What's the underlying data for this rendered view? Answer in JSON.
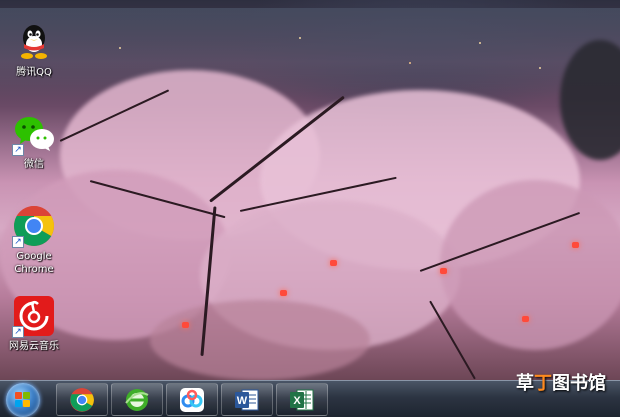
{
  "desktop": {
    "icons": [
      {
        "label": "腾讯QQ",
        "icon": "qq-penguin-icon"
      },
      {
        "label": "微信",
        "icon": "wechat-icon"
      },
      {
        "label": "Google\nChrome",
        "icon": "chrome-icon"
      },
      {
        "label": "网易云音乐",
        "icon": "netease-music-icon"
      }
    ]
  },
  "taskbar": {
    "start": {
      "icon": "windows-start-icon"
    },
    "pinned": [
      {
        "icon": "chrome-icon"
      },
      {
        "icon": "ie-browser-icon"
      },
      {
        "icon": "baidu-netdisk-icon"
      },
      {
        "icon": "word-icon",
        "letter": "W"
      },
      {
        "icon": "excel-icon",
        "letter": "X"
      }
    ]
  },
  "watermark": {
    "part1": "草",
    "part2": "丁",
    "part3": "图书馆"
  },
  "colors": {
    "qq_black": "#111111",
    "qq_yellow": "#f4b400",
    "qq_red": "#e53935",
    "wechat_green": "#2dc100",
    "chrome_red": "#db4437",
    "chrome_yellow": "#f4c20d",
    "chrome_green": "#0f9d58",
    "chrome_blue": "#4285f4",
    "netease_red": "#e21b1b",
    "word_blue": "#2b579a",
    "excel_green": "#217346",
    "ie_green": "#3fae29"
  }
}
